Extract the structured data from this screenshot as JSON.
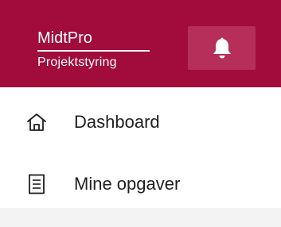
{
  "header": {
    "brand_name": "MidtPro",
    "brand_subtitle": "Projektstyring",
    "background_color": "#a10c3c",
    "notifications_icon": "bell-icon"
  },
  "nav": {
    "items": [
      {
        "label": "Dashboard",
        "icon": "home-icon"
      },
      {
        "label": "Mine opgaver",
        "icon": "document-list-icon"
      }
    ]
  }
}
